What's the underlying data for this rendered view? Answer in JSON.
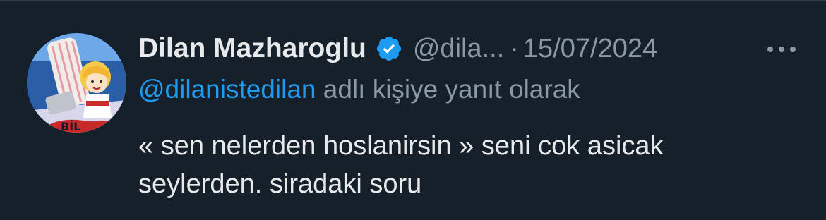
{
  "tweet": {
    "author": {
      "display_name": "Dilan Mazharoglu",
      "handle": "@dila...",
      "verified": true,
      "verified_icon": "verified-badge-icon",
      "avatar_icon": "avatar-illustration"
    },
    "separator": "·",
    "timestamp": "15/07/2024",
    "more_icon": "more-horizontal-icon",
    "reply_to": {
      "mention": "@dilanistedilan",
      "suffix": " adlı kişiye yanıt olarak"
    },
    "text": "« sen nelerden hoslanirsin » seni cok asicak\nseylerden. siradaki soru"
  },
  "colors": {
    "background": "#15202b",
    "primary_text": "#e7e9ea",
    "secondary_text": "#8b98a5",
    "accent": "#1d9bf0"
  }
}
